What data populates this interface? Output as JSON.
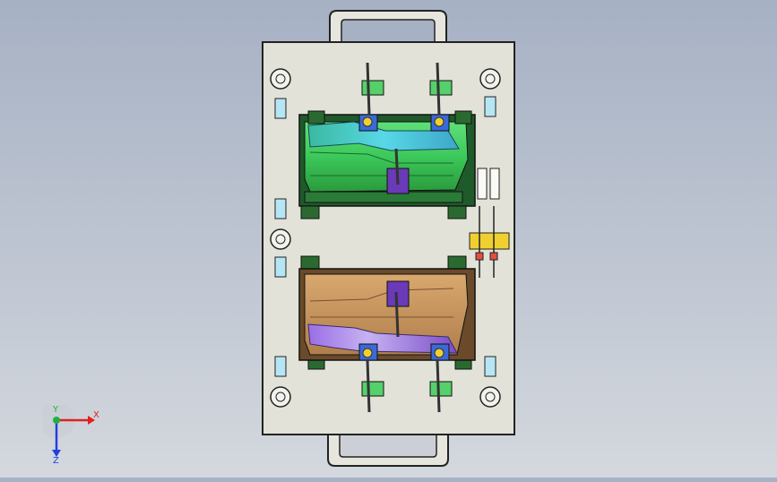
{
  "viewport": {
    "background": "#b5bdca",
    "plate_color": "#e2e2d8",
    "upper_part_colors": [
      "#3fd35a",
      "#37b7c6",
      "#2f9a3c"
    ],
    "lower_part_colors": [
      "#c89660",
      "#8a5bd6",
      "#b07e4c"
    ]
  },
  "triad": {
    "x_label": "X",
    "y_label": "Y",
    "z_label": "Z",
    "x_color": "#e02020",
    "y_color": "#20b040",
    "z_color": "#2040e0"
  }
}
